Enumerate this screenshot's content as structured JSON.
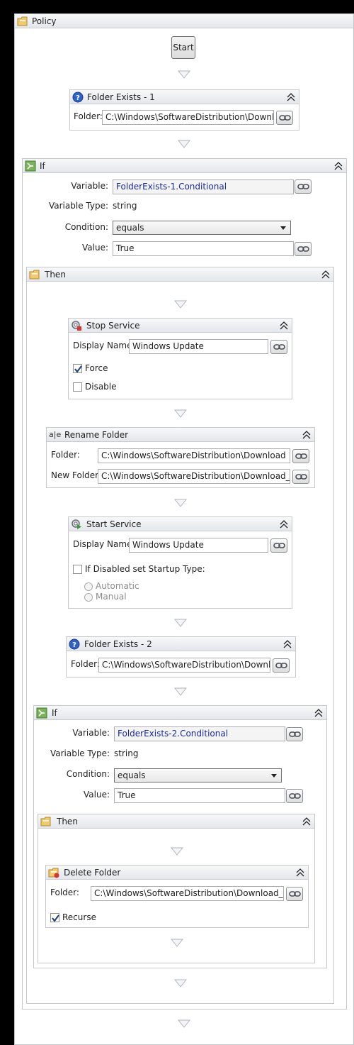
{
  "policy": {
    "title": "Policy",
    "start_label": "Start"
  },
  "folder_exists_1": {
    "title": "Folder Exists - 1",
    "folder_label": "Folder:",
    "folder_value": "C:\\Windows\\SoftwareDistribution\\Download"
  },
  "if_1": {
    "title": "If",
    "variable_label": "Variable:",
    "variable_value": "FolderExists-1.Conditional",
    "variable_type_label": "Variable Type:",
    "variable_type_value": "string",
    "condition_label": "Condition:",
    "condition_value": "equals",
    "value_label": "Value:",
    "value_value": "True"
  },
  "then_1": {
    "title": "Then"
  },
  "stop_service": {
    "title": "Stop Service",
    "display_name_label": "Display Name:",
    "display_name_value": "Windows Update",
    "force_label": "Force",
    "force_checked": true,
    "disable_label": "Disable",
    "disable_checked": false
  },
  "rename_folder": {
    "title": "Rename Folder",
    "folder_label": "Folder:",
    "folder_value": "C:\\Windows\\SoftwareDistribution\\Download",
    "new_folder_label": "New Folder:",
    "new_folder_value": "C:\\Windows\\SoftwareDistribution\\Download_OLD"
  },
  "start_service": {
    "title": "Start Service",
    "display_name_label": "Display Name:",
    "display_name_value": "Windows Update",
    "if_disabled_label": "If Disabled set Startup Type:",
    "if_disabled_checked": false,
    "automatic_label": "Automatic",
    "manual_label": "Manual"
  },
  "folder_exists_2": {
    "title": "Folder Exists - 2",
    "folder_label": "Folder:",
    "folder_value": "C:\\Windows\\SoftwareDistribution\\Download"
  },
  "if_2": {
    "title": "If",
    "variable_label": "Variable:",
    "variable_value": "FolderExists-2.Conditional",
    "variable_type_label": "Variable Type:",
    "variable_type_value": "string",
    "condition_label": "Condition:",
    "condition_value": "equals",
    "value_label": "Value:",
    "value_value": "True"
  },
  "then_2": {
    "title": "Then"
  },
  "delete_folder": {
    "title": "Delete Folder",
    "folder_label": "Folder:",
    "folder_value": "C:\\Windows\\SoftwareDistribution\\Download_OLD",
    "recurse_label": "Recurse",
    "recurse_checked": true
  },
  "colors": {
    "header": "#e4e7eb",
    "border": "#c7c8c9",
    "variable_text": "#1a2a9c",
    "connector": "#b8bcc4"
  }
}
